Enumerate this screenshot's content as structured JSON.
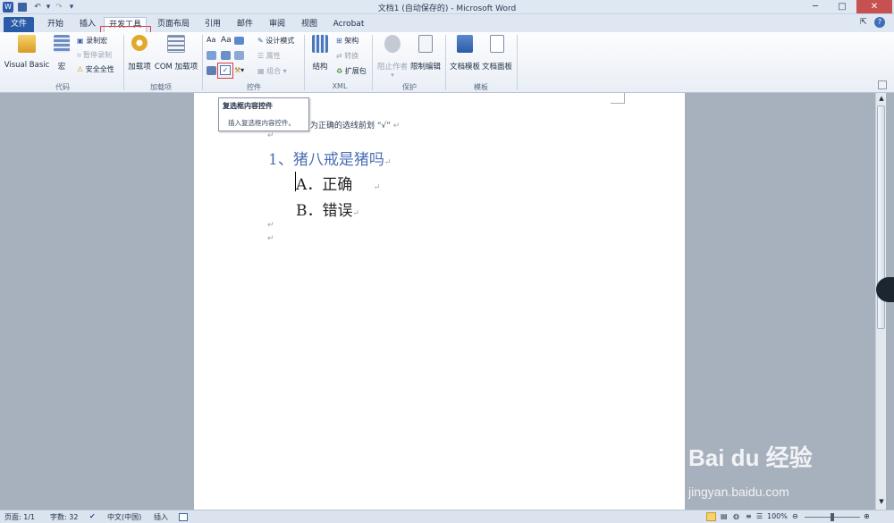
{
  "window": {
    "title": "文档1 (自动保存的) - Microsoft Word"
  },
  "tabs": [
    {
      "label": "文件"
    },
    {
      "label": "开始"
    },
    {
      "label": "插入"
    },
    {
      "label": "开发工具"
    },
    {
      "label": "页面布局"
    },
    {
      "label": "引用"
    },
    {
      "label": "邮件"
    },
    {
      "label": "审阅"
    },
    {
      "label": "视图"
    },
    {
      "label": "Acrobat"
    }
  ],
  "ribbon": {
    "code": {
      "label": "代码",
      "visual_basic": "Visual Basic",
      "macros": "宏",
      "record": "录制宏",
      "pause": "暂停录制",
      "security": "安全全性"
    },
    "addins": {
      "label": "加载项",
      "addins_btn": "加载项",
      "com_btn": "COM 加载项"
    },
    "controls": {
      "label": "控件",
      "design_mode": "设计模式",
      "properties": "属性",
      "group": "组合"
    },
    "xml": {
      "label": "XML",
      "structure": "结构",
      "schema": "架构",
      "transform": "转换",
      "expansion": "扩展包"
    },
    "protect": {
      "label": "保护",
      "block_authors": "阻止作者",
      "restrict": "限制编辑"
    },
    "templates": {
      "label": "模板",
      "doc_template": "文档模板",
      "doc_panel": "文档面板"
    }
  },
  "tooltip": {
    "title": "复选框内容控件",
    "desc": "插入复选框内容控件。"
  },
  "document": {
    "instruction": "为正确的选线前划 “√”",
    "question": "1、猪八戒是猪吗",
    "option_a": "A．正确",
    "option_b": "B．错误",
    "para_mark": "↵"
  },
  "status": {
    "page": "页面: 1/1",
    "words": "字数: 32",
    "lang": "中文(中国)",
    "mode": "插入",
    "zoom": "100%"
  },
  "watermark": {
    "brand": "Bai du 经验",
    "url": "jingyan.baidu.com"
  },
  "colors": {
    "file_tab": "#2a5ba9",
    "highlight": "#e03b3b",
    "question_text": "#4a6fb5"
  }
}
